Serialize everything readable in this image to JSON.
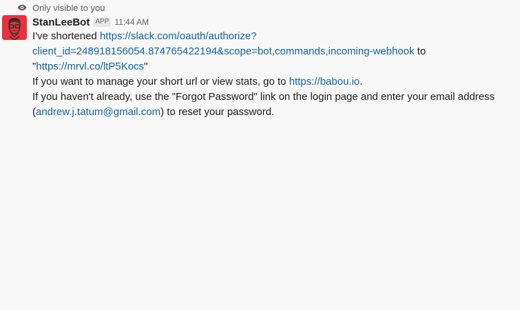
{
  "visibility_note": "Only visible to you",
  "sender": {
    "name": "StanLeeBot",
    "badge": "APP",
    "timestamp": "11:44 AM"
  },
  "message": {
    "line1_prefix": "I've shortened ",
    "line1_link": "https://slack.com/oauth/authorize?",
    "line2_link": "client_id=248918156054.874765422194&scope=bot,commands,incoming-webhook",
    "line2_suffix": " to",
    "line3_quote_open": "\"",
    "line3_link": "https://mrvl.co/ltP5Kocs",
    "line3_quote_close": "\"",
    "line4_prefix": "If you want to manage your short url or view stats, go to ",
    "line4_link": "https://babou.io",
    "line4_suffix": ".",
    "line5": "If you haven't already, use the \"Forgot Password\" link on the login page and enter your email address",
    "line6_open": "(",
    "line6_email": "andrew.j.tatum@gmail.com",
    "line6_suffix": ") to reset your password."
  },
  "colors": {
    "avatar_bg": "#e8323d",
    "link": "#1264a3",
    "muted": "#616061"
  },
  "icons": {
    "visibility": "eye-icon",
    "avatar": "stan-lee-avatar"
  }
}
